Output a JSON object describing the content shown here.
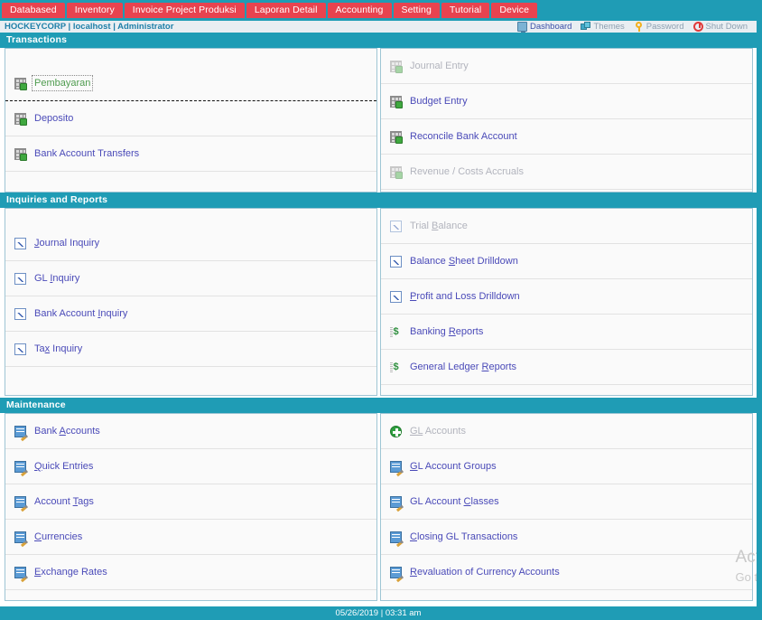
{
  "topnav": {
    "tabs": [
      {
        "label": "Databased"
      },
      {
        "label": "Inventory"
      },
      {
        "label": "Invoice Project Produksi"
      },
      {
        "label": "Laporan Detail"
      },
      {
        "label": "Accounting"
      },
      {
        "label": "Setting"
      },
      {
        "label": "Tutorial"
      },
      {
        "label": "Device"
      }
    ]
  },
  "userbar": {
    "who": "HOCKEYCORP | localhost | Administrator",
    "tools": [
      {
        "label": "Dashboard",
        "icon": "monitor-icon",
        "active": true
      },
      {
        "label": "Themes",
        "icon": "themes-icon",
        "active": false
      },
      {
        "label": "Password",
        "icon": "key-icon",
        "active": false
      },
      {
        "label": "Shut Down",
        "icon": "power-icon",
        "active": false
      }
    ]
  },
  "sections": [
    {
      "title": "Transactions",
      "left": [
        {
          "label": "Pembayaran",
          "icon": "table-icon",
          "state": "visited-focused",
          "accesskey": "",
          "divider": "dashed"
        },
        {
          "label": "Deposito",
          "icon": "table-icon",
          "state": "normal",
          "accesskey": "",
          "divider": "solid"
        },
        {
          "label": "Bank Account Transfers",
          "icon": "table-icon",
          "state": "normal",
          "accesskey": "",
          "divider": "solid"
        }
      ],
      "right": [
        {
          "label": "Journal Entry",
          "icon": "table-icon",
          "state": "disabled",
          "accesskey": "",
          "divider": "solid"
        },
        {
          "label": "Budget Entry",
          "icon": "table-icon",
          "state": "normal",
          "accesskey": "",
          "divider": "solid"
        },
        {
          "label": "Reconcile Bank Account",
          "icon": "table-icon",
          "state": "normal",
          "accesskey": "",
          "divider": "solid"
        },
        {
          "label": "Revenue / Costs Accruals",
          "icon": "table-icon",
          "state": "disabled",
          "accesskey": "",
          "divider": "solid"
        }
      ]
    },
    {
      "title": "Inquiries and Reports",
      "left": [
        {
          "label": "Journal Inquiry",
          "icon": "chart-icon",
          "state": "normal",
          "accesskey": "J",
          "divider": "solid"
        },
        {
          "label": "GL Inquiry",
          "icon": "chart-icon",
          "state": "normal",
          "accesskey": "I",
          "divider": "solid"
        },
        {
          "label": "Bank Account Inquiry",
          "icon": "chart-icon",
          "state": "normal",
          "accesskey": "I",
          "divider": "solid"
        },
        {
          "label": "Tax Inquiry",
          "icon": "chart-icon",
          "state": "normal",
          "accesskey": "x",
          "divider": "solid"
        }
      ],
      "right": [
        {
          "label": "Trial Balance",
          "icon": "chart-icon",
          "state": "disabled",
          "accesskey": "B",
          "divider": "solid"
        },
        {
          "label": "Balance Sheet Drilldown",
          "icon": "chart-icon",
          "state": "normal",
          "accesskey": "S",
          "divider": "solid"
        },
        {
          "label": "Profit and Loss Drilldown",
          "icon": "chart-icon",
          "state": "normal",
          "accesskey": "P",
          "divider": "solid"
        },
        {
          "label": "Banking Reports",
          "icon": "dollar-icon",
          "state": "normal",
          "accesskey": "R",
          "divider": "solid"
        },
        {
          "label": "General Ledger Reports",
          "icon": "dollar-icon",
          "state": "normal",
          "accesskey": "R",
          "divider": "solid"
        }
      ]
    },
    {
      "title": "Maintenance",
      "left": [
        {
          "label": "Bank Accounts",
          "icon": "doc-pencil-icon",
          "state": "normal",
          "accesskey": "A",
          "divider": "solid"
        },
        {
          "label": "Quick Entries",
          "icon": "doc-pencil-icon",
          "state": "normal",
          "accesskey": "Q",
          "divider": "solid"
        },
        {
          "label": "Account Tags",
          "icon": "doc-pencil-icon",
          "state": "normal",
          "accesskey": "T",
          "divider": "solid"
        },
        {
          "label": "Currencies",
          "icon": "doc-pencil-icon",
          "state": "normal",
          "accesskey": "C",
          "divider": "solid"
        },
        {
          "label": "Exchange Rates",
          "icon": "doc-pencil-icon",
          "state": "normal",
          "accesskey": "E",
          "divider": "solid"
        }
      ],
      "right": [
        {
          "label": "GL Accounts",
          "icon": "plus-circle-icon",
          "state": "disabled",
          "accesskey": "GL",
          "divider": "solid"
        },
        {
          "label": "GL Account Groups",
          "icon": "doc-pencil-icon",
          "state": "normal",
          "accesskey": "G",
          "divider": "solid"
        },
        {
          "label": "GL Account Classes",
          "icon": "doc-pencil-icon",
          "state": "normal",
          "accesskey": "C",
          "divider": "solid"
        },
        {
          "label": "Closing GL Transactions",
          "icon": "doc-pencil-icon",
          "state": "normal",
          "accesskey": "C",
          "divider": "solid"
        },
        {
          "label": "Revaluation of Currency Accounts",
          "icon": "doc-pencil-icon",
          "state": "normal",
          "accesskey": "R",
          "divider": "solid"
        }
      ]
    }
  ],
  "footer": {
    "text": "05/26/2019 | 03:31 am"
  },
  "watermark": {
    "line1": "Act",
    "line2": "Go t"
  },
  "colors": {
    "teal": "#1f9cb5",
    "tab_red": "#e8434f",
    "link_blue": "#4a4ab8",
    "disabled_grey": "#b2b4bd",
    "visited_green": "#4f9c4f",
    "userbar_bg": "#e9eef2",
    "panel_bg": "#fafafa",
    "panel_border": "#9ec5d4"
  }
}
